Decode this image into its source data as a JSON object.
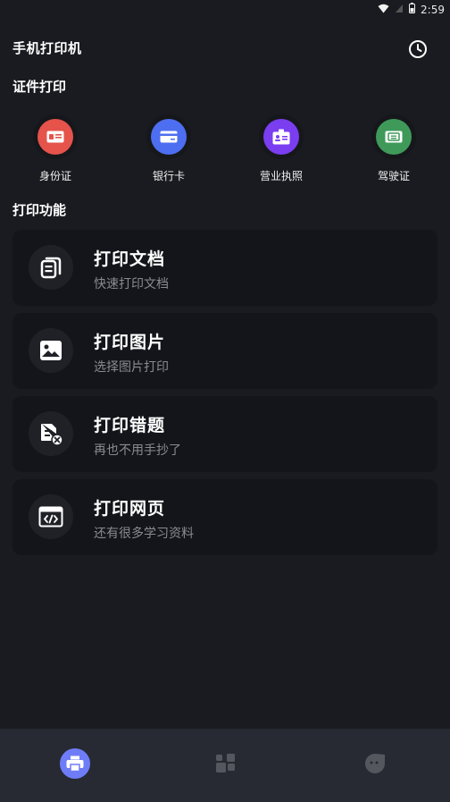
{
  "status_bar": {
    "time": "2:59"
  },
  "app": {
    "title": "手机打印机",
    "history_icon": "clock-icon"
  },
  "sections": {
    "cert": "证件打印",
    "functions": "打印功能"
  },
  "cert_items": [
    {
      "label": "身份证",
      "icon": "id-card-icon",
      "color": "#e5534b"
    },
    {
      "label": "银行卡",
      "icon": "bank-card-icon",
      "color": "#4d6ef0"
    },
    {
      "label": "营业执照",
      "icon": "business-license-icon",
      "color": "#7a3df0"
    },
    {
      "label": "驾驶证",
      "icon": "driver-license-icon",
      "color": "#3f9a5a"
    }
  ],
  "function_cards": [
    {
      "title": "打印文档",
      "subtitle": "快速打印文档",
      "icon": "document-icon"
    },
    {
      "title": "打印图片",
      "subtitle": "选择图片打印",
      "icon": "image-icon"
    },
    {
      "title": "打印错题",
      "subtitle": "再也不用手抄了",
      "icon": "wrong-question-icon"
    },
    {
      "title": "打印网页",
      "subtitle": "还有很多学习资料",
      "icon": "webpage-icon"
    }
  ],
  "bottom_nav": [
    {
      "icon": "printer-icon",
      "active": true,
      "accent": "#6f7cf7"
    },
    {
      "icon": "apps-grid-icon",
      "active": false
    },
    {
      "icon": "profile-icon",
      "active": false
    }
  ]
}
